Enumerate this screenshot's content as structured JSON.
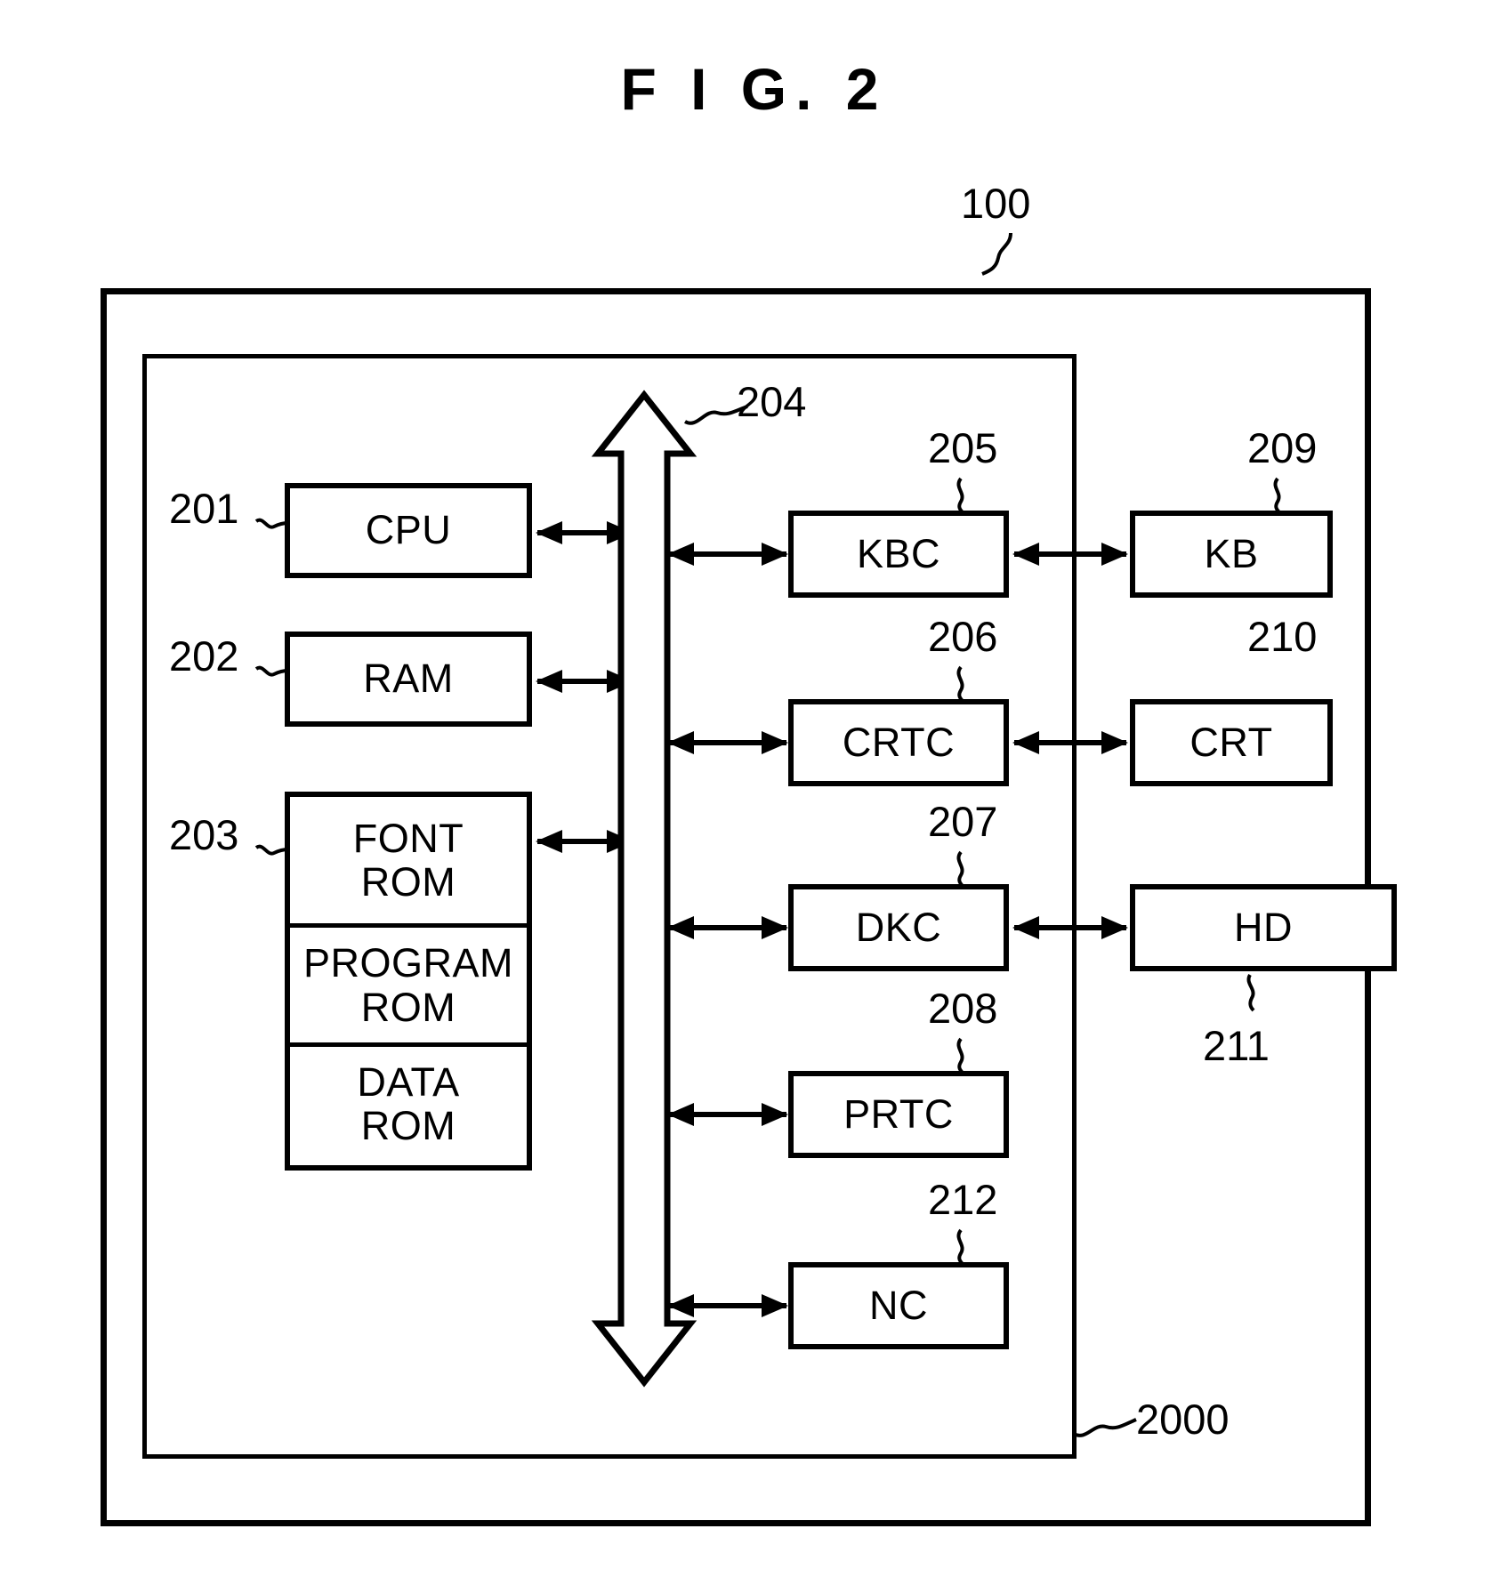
{
  "figure": {
    "title": "F I G.  2"
  },
  "refs": {
    "system": "100",
    "host_unit": "2000",
    "cpu": "201",
    "ram": "202",
    "rom": "203",
    "bus": "204",
    "kbc": "205",
    "crtc": "206",
    "dkc": "207",
    "prtc": "208",
    "kb": "209",
    "crt": "210",
    "hd": "211",
    "nc": "212"
  },
  "blocks": {
    "cpu": "CPU",
    "ram": "RAM",
    "rom": {
      "font_rom": "FONT\nROM",
      "program_rom": "PROGRAM\nROM",
      "data_rom": "DATA\nROM"
    },
    "kbc": "KBC",
    "crtc": "CRTC",
    "dkc": "DKC",
    "prtc": "PRTC",
    "nc": "NC",
    "kb": "KB",
    "crt": "CRT",
    "hd": "HD"
  }
}
